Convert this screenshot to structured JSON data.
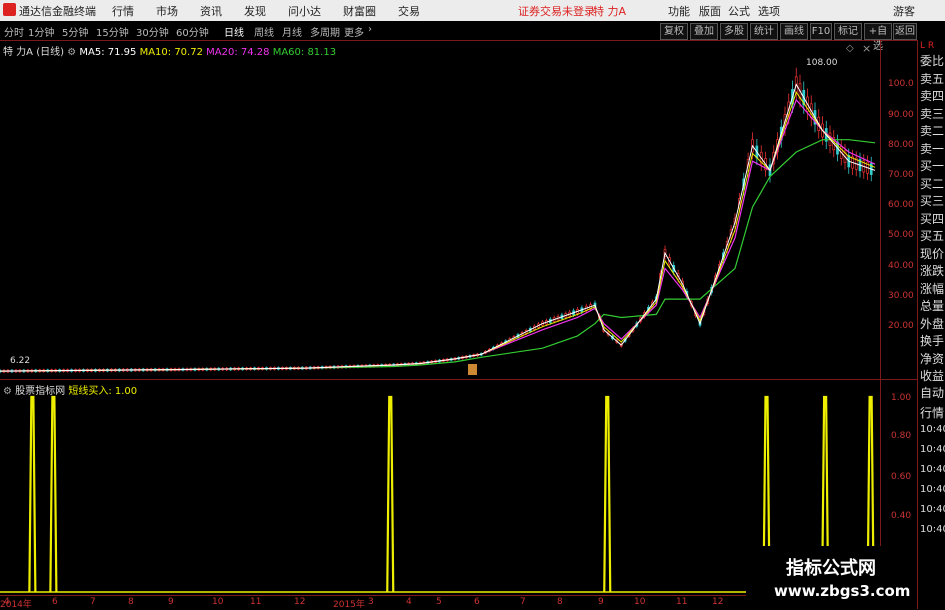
{
  "menu": {
    "app_title": "通达信金融终端",
    "items": [
      "行情",
      "市场",
      "资讯",
      "发现",
      "问小达",
      "财富圈",
      "交易"
    ],
    "login_status": "证券交易未登录",
    "stock_name": "特 力A",
    "right_items": [
      "功能",
      "版面",
      "公式",
      "选项"
    ],
    "guest": "游客"
  },
  "toolbar": {
    "periods": [
      "分时",
      "1分钟",
      "5分钟",
      "15分钟",
      "30分钟",
      "60分钟",
      "日线",
      "周线",
      "月线",
      "多周期",
      "更多"
    ],
    "active_period": "日线",
    "buttons": [
      "复权",
      "叠加",
      "多股",
      "统计",
      "画线",
      "F10",
      "标记",
      "+自选",
      "返回"
    ]
  },
  "price_header": {
    "stock": "特 力A",
    "period": "(日线)",
    "ma5": "MA5: 71.95",
    "ma10": "MA10: 70.72",
    "ma20": "MA20: 74.28",
    "ma60": "MA60: 81.13"
  },
  "price_axis": {
    "ticks": [
      "100.0",
      "90.00",
      "80.00",
      "70.00",
      "60.00",
      "50.00",
      "40.00",
      "30.00",
      "20.00"
    ],
    "high_label": "108.00",
    "low_label": "6.22"
  },
  "indicator_header": {
    "name": "股票指标网",
    "value": "短线买入: 1.00"
  },
  "indicator_axis": {
    "ticks": [
      "1.00",
      "0.80",
      "0.60",
      "0.40"
    ]
  },
  "x_axis": {
    "labels": [
      "2014年",
      "4",
      "6",
      "7",
      "8",
      "9",
      "10",
      "11",
      "12",
      "2015年",
      "3",
      "4",
      "5",
      "6",
      "7",
      "8",
      "9",
      "10",
      "11",
      "12"
    ]
  },
  "side_panel": {
    "labels": [
      "委比",
      "卖五",
      "卖四",
      "卖三",
      "卖二",
      "卖一",
      "买一",
      "买二",
      "买三",
      "买四",
      "买五",
      "现价",
      "涨跌",
      "涨幅",
      "总量",
      "外盘",
      "换手",
      "净资",
      "收益"
    ],
    "lower_labels": [
      "自动",
      "行情",
      "10:40",
      "10:40",
      "10:40",
      "10:40",
      "10:40",
      "10:40"
    ],
    "corner": "L R"
  },
  "watermark": {
    "title": "指标公式网",
    "url": "www.zbgs3.com"
  },
  "chart_data": {
    "type": "line",
    "title": "",
    "series": [
      {
        "name": "MA5",
        "values": [
          6.5,
          7,
          7.5,
          8.5,
          9,
          10.5,
          12,
          22,
          26,
          28,
          20,
          15,
          30,
          45,
          35,
          22,
          55,
          80,
          72,
          100,
          85,
          75,
          72
        ]
      },
      {
        "name": "MA20",
        "values": [
          6.5,
          7,
          7.5,
          8.5,
          9,
          10.5,
          12,
          20,
          24,
          27,
          22,
          17,
          28,
          40,
          33,
          24,
          50,
          75,
          72,
          95,
          85,
          78,
          74
        ]
      },
      {
        "name": "MA60",
        "values": [
          6.5,
          7,
          7.5,
          8,
          8.5,
          9.5,
          11,
          14,
          18,
          22,
          25,
          24,
          25,
          30,
          30,
          30,
          40,
          60,
          70,
          78,
          82,
          82,
          81
        ]
      }
    ],
    "ylim": [
      6.22,
      108
    ],
    "indicator": {
      "name": "短线买入",
      "signal_positions_pct": [
        3.7,
        6.1,
        44.6,
        69.4,
        87.6,
        94.3,
        99.5
      ],
      "value": 1.0
    }
  }
}
